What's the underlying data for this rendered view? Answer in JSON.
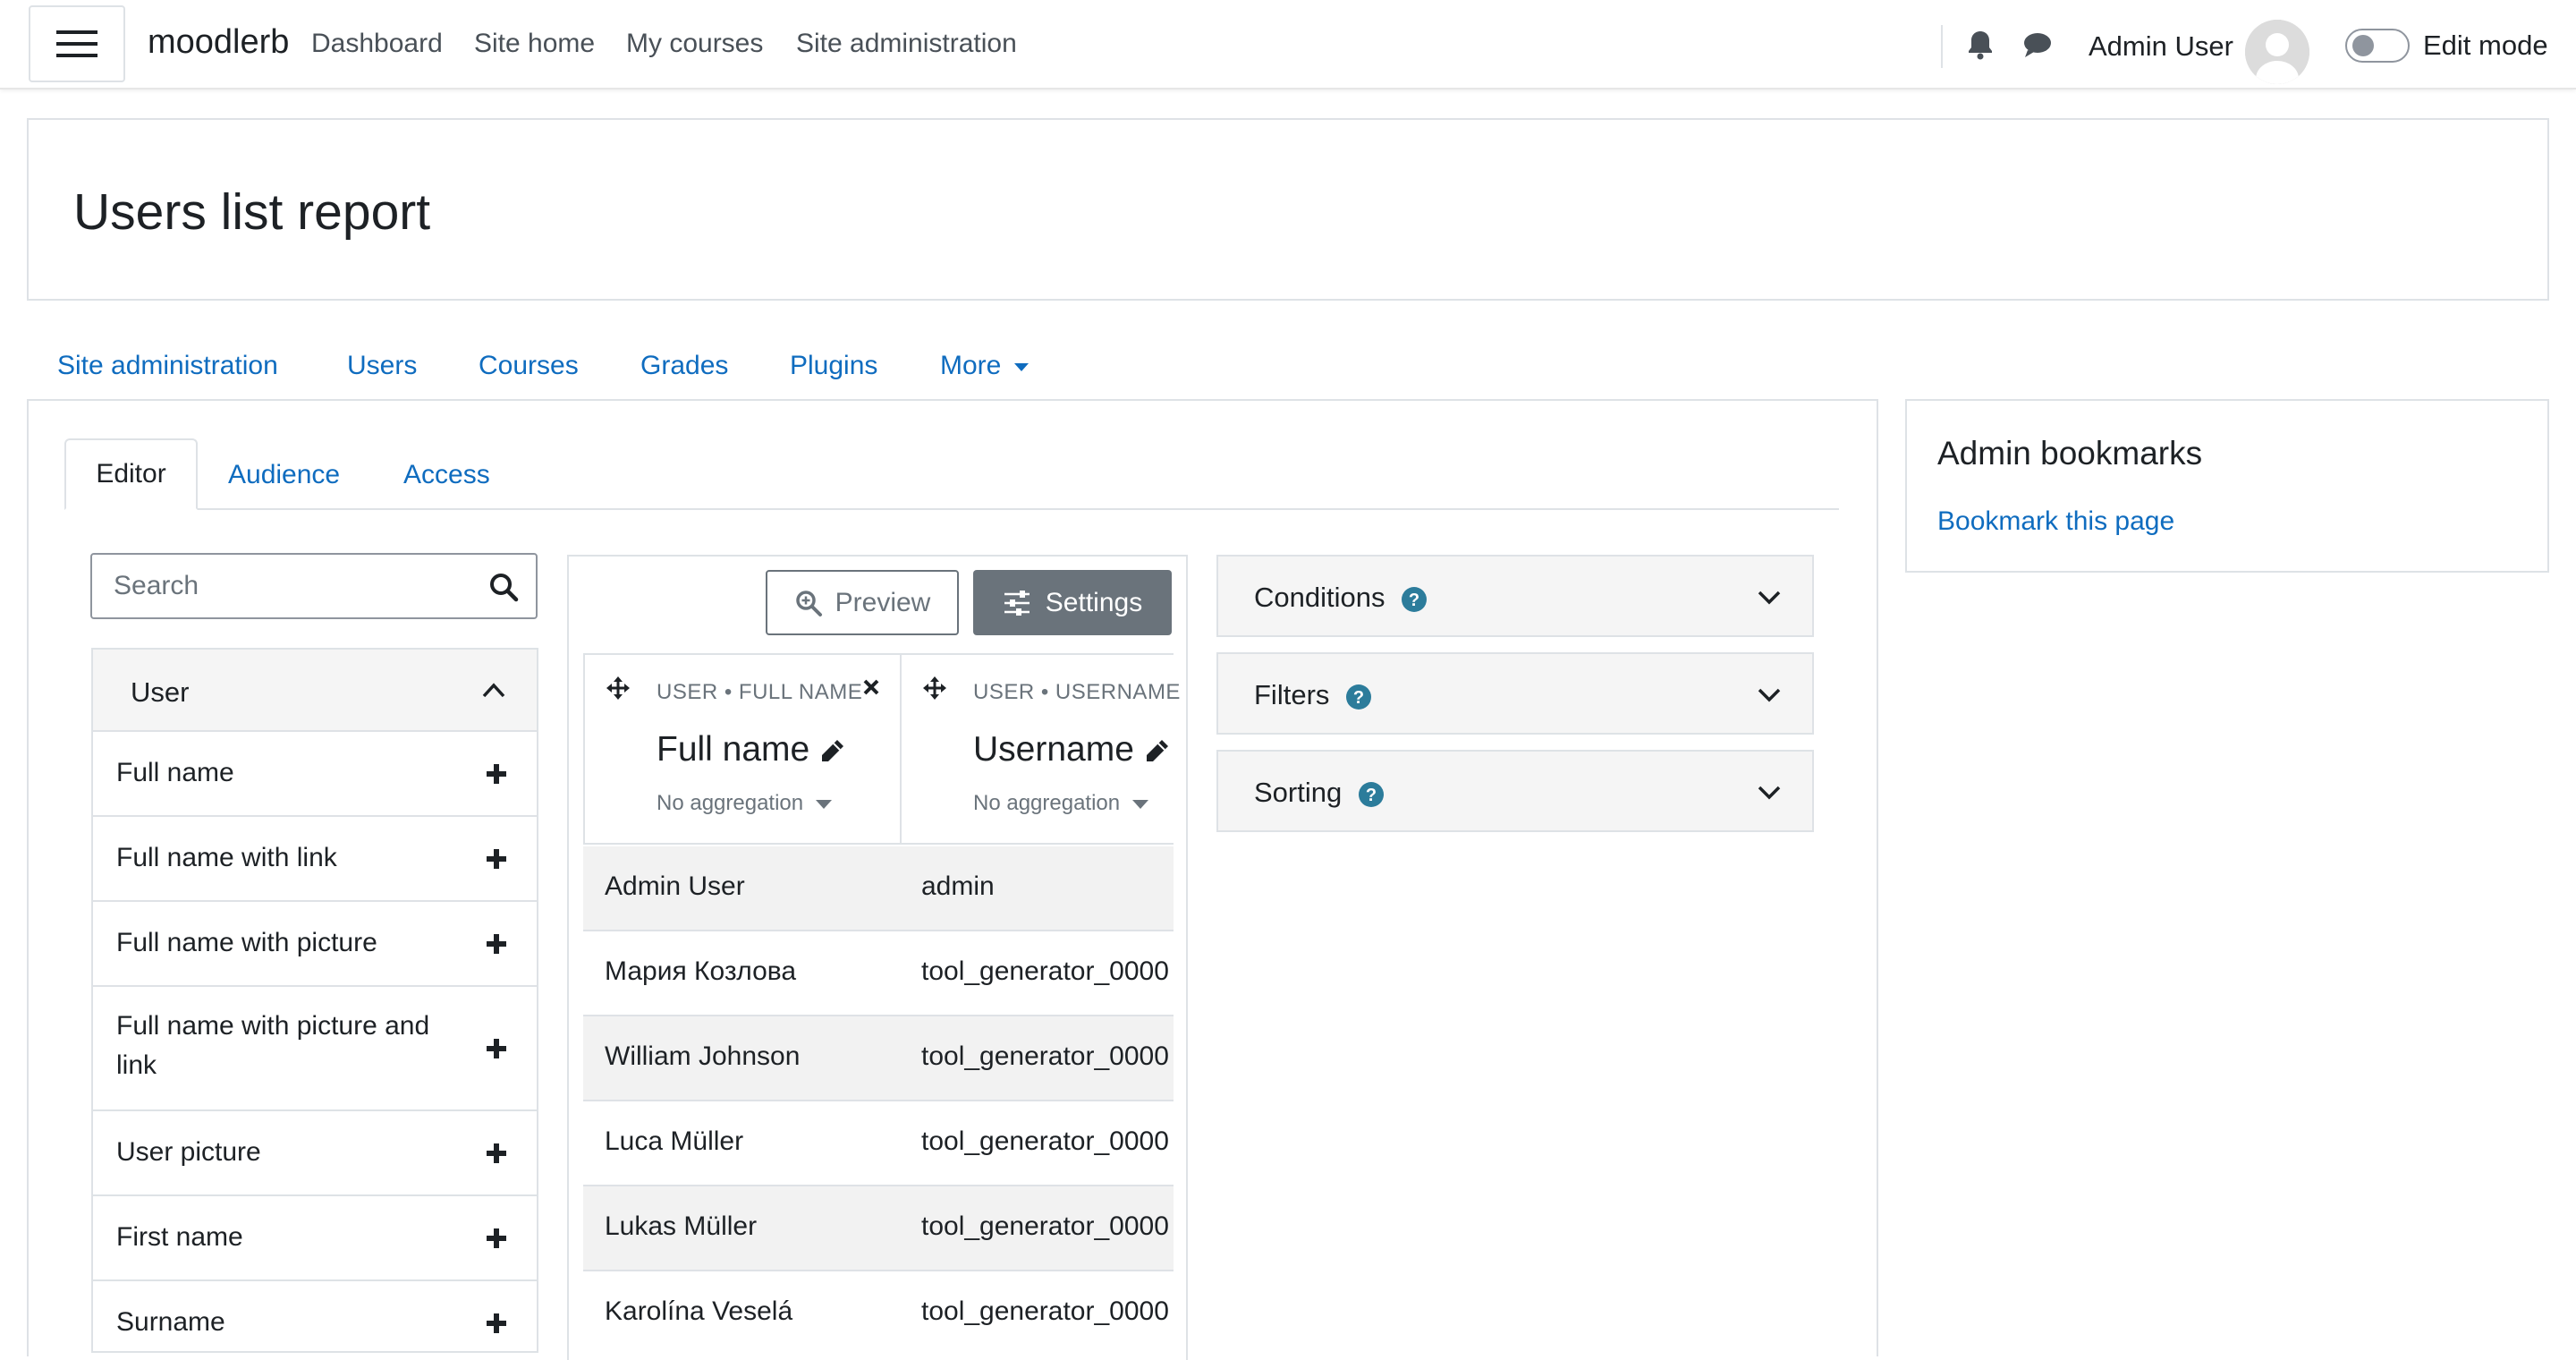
{
  "navbar": {
    "brand": "moodlerb",
    "links": [
      "Dashboard",
      "Site home",
      "My courses",
      "Site administration"
    ],
    "user_name": "Admin User",
    "edit_mode_label": "Edit mode",
    "edit_mode_on": false,
    "icons": [
      "menu-icon",
      "bell-icon",
      "chat-icon",
      "avatar"
    ]
  },
  "page": {
    "title": "Users list report"
  },
  "secondary_nav": [
    "Site administration",
    "Users",
    "Courses",
    "Grades",
    "Plugins",
    "More"
  ],
  "tabs": {
    "active": "Editor",
    "items": [
      "Editor",
      "Audience",
      "Access"
    ]
  },
  "sidebar": {
    "search_placeholder": "Search",
    "group_label": "User",
    "fields": [
      "Full name",
      "Full name with link",
      "Full name with picture",
      "Full name with picture and link",
      "User picture",
      "First name",
      "Surname"
    ]
  },
  "toolbar": {
    "preview_label": "Preview",
    "settings_label": "Settings"
  },
  "columns": [
    {
      "meta": "USER • FULL NAME",
      "title": "Full name",
      "aggregation": "No aggregation"
    },
    {
      "meta": "USER • USERNAME",
      "title": "Username",
      "aggregation": "No aggregation"
    }
  ],
  "rows": [
    {
      "full_name": "Admin User",
      "username": "admin"
    },
    {
      "full_name": "Мария Козлова",
      "username": "tool_generator_0000"
    },
    {
      "full_name": "William Johnson",
      "username": "tool_generator_0000"
    },
    {
      "full_name": "Luca Müller",
      "username": "tool_generator_0000"
    },
    {
      "full_name": "Lukas Müller",
      "username": "tool_generator_0000"
    },
    {
      "full_name": "Karolína Veselá",
      "username": "tool_generator_0000"
    }
  ],
  "panels": [
    "Conditions",
    "Filters",
    "Sorting"
  ],
  "block": {
    "title": "Admin bookmarks",
    "link": "Bookmark this page"
  },
  "colors": {
    "link": "#0f6cbf",
    "secondary": "#6a737b",
    "border": "#dee2e6",
    "help": "#2c7c9b"
  }
}
